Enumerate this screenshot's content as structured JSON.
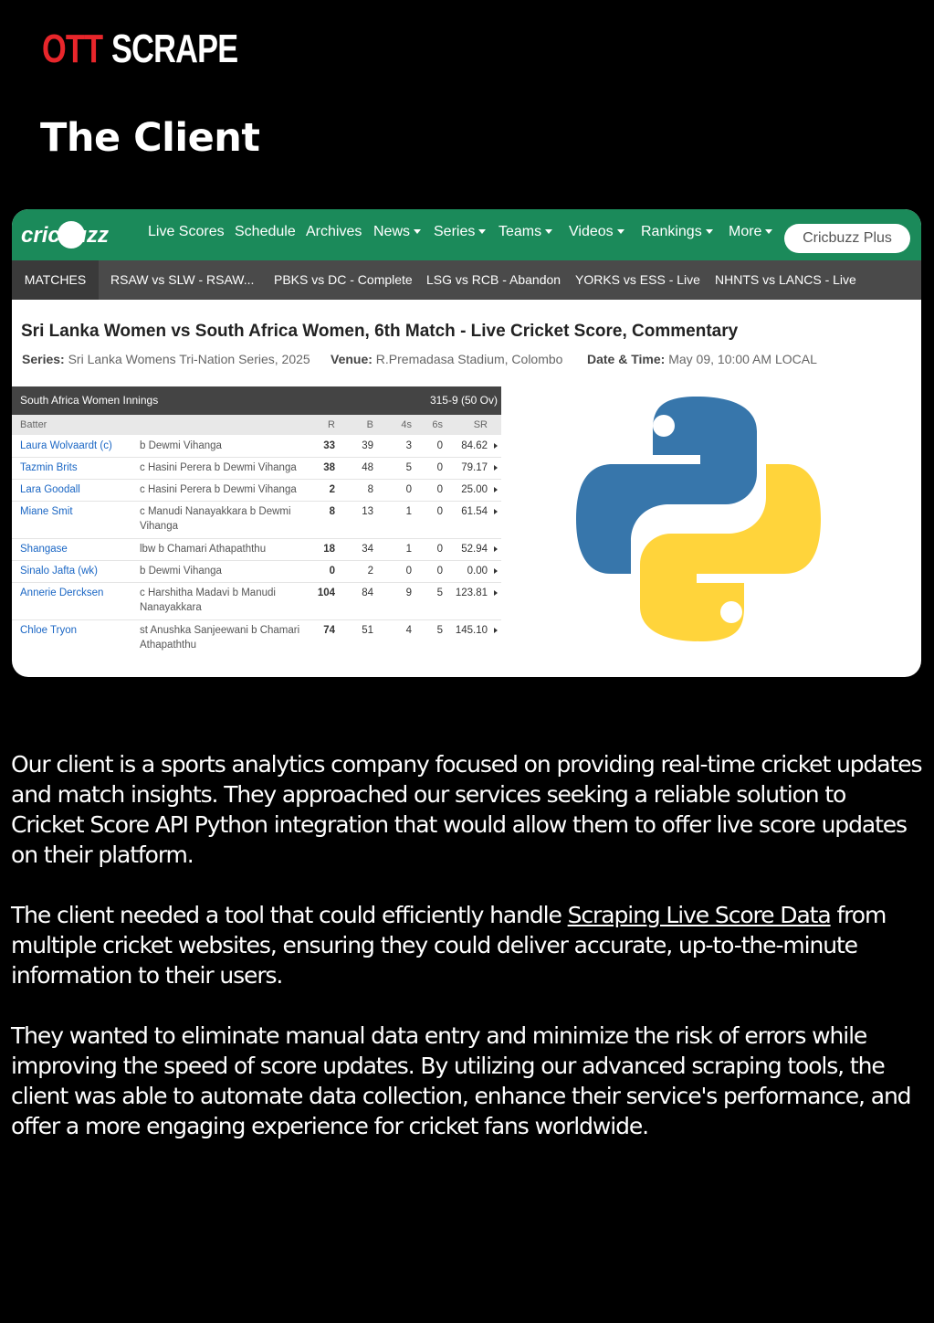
{
  "brand": {
    "logo_ott": "OTT",
    "logo_scrape": "SCRAPE",
    "ott_color": "#e8262b"
  },
  "section_title": "The Client",
  "screenshot": {
    "site_logo": "cricbuzz",
    "nav": [
      "Live Scores",
      "Schedule",
      "Archives",
      "News",
      "Series",
      "Teams",
      "Videos",
      "Rankings",
      "More"
    ],
    "plus_button": "Cricbuzz Plus",
    "matches_label": "MATCHES",
    "matches": [
      "RSAW vs SLW - RSAW...",
      "PBKS vs DC - Complete",
      "LSG vs RCB - Abandon",
      "YORKS vs ESS - Live",
      "NHNTS vs LANCS - Live"
    ],
    "title": "Sri Lanka Women vs South Africa Women, 6th Match - Live Cricket Score, Commentary",
    "series_label": "Series:",
    "series": "Sri Lanka Womens Tri-Nation Series, 2025",
    "venue_label": "Venue:",
    "venue": "R.Premadasa Stadium, Colombo",
    "date_label": "Date & Time:",
    "date": "May 09, 10:00 AM LOCAL",
    "innings_team": "South Africa Women Innings",
    "innings_total": "315-9 (50 Ov)",
    "columns": {
      "batter": "Batter",
      "r": "R",
      "b": "B",
      "fours": "4s",
      "sixes": "6s",
      "sr": "SR"
    },
    "rows": [
      {
        "batter": "Laura Wolvaardt (c)",
        "dismissal": "b Dewmi Vihanga",
        "r": "33",
        "b": "39",
        "fours": "3",
        "sixes": "0",
        "sr": "84.62"
      },
      {
        "batter": "Tazmin Brits",
        "dismissal": "c Hasini Perera b Dewmi Vihanga",
        "r": "38",
        "b": "48",
        "fours": "5",
        "sixes": "0",
        "sr": "79.17"
      },
      {
        "batter": "Lara Goodall",
        "dismissal": "c Hasini Perera b Dewmi Vihanga",
        "r": "2",
        "b": "8",
        "fours": "0",
        "sixes": "0",
        "sr": "25.00"
      },
      {
        "batter": "Miane Smit",
        "dismissal": "c Manudi Nanayakkara b Dewmi Vihanga",
        "r": "8",
        "b": "13",
        "fours": "1",
        "sixes": "0",
        "sr": "61.54"
      },
      {
        "batter": "Shangase",
        "dismissal": "lbw b Chamari Athapaththu",
        "r": "18",
        "b": "34",
        "fours": "1",
        "sixes": "0",
        "sr": "52.94"
      },
      {
        "batter": "Sinalo Jafta (wk)",
        "dismissal": "b Dewmi Vihanga",
        "r": "0",
        "b": "2",
        "fours": "0",
        "sixes": "0",
        "sr": "0.00"
      },
      {
        "batter": "Annerie Dercksen",
        "dismissal": "c Harshitha Madavi b Manudi Nanayakkara",
        "r": "104",
        "b": "84",
        "fours": "9",
        "sixes": "5",
        "sr": "123.81"
      },
      {
        "batter": "Chloe Tryon",
        "dismissal": "st Anushka Sanjeewani b Chamari Athapaththu",
        "r": "74",
        "b": "51",
        "fours": "4",
        "sixes": "5",
        "sr": "145.10"
      }
    ]
  },
  "paragraphs": {
    "p1": "Our client is a sports analytics company focused on providing real-time cricket updates and match insights. They approached our services seeking a reliable solution to Cricket Score API Python integration that would allow them to offer live score updates on their platform.",
    "p2_before": "The client needed a tool that could efficiently handle ",
    "p2_link": "Scraping Live Score Data",
    "p2_after": " from multiple cricket websites, ensuring they could deliver accurate, up-to-the-minute information to their users.",
    "p3": "They wanted to eliminate manual data entry and minimize the risk of errors while improving the speed of score updates. By utilizing our advanced scraping tools, the client was able to automate data collection, enhance their service's performance, and offer a more engaging experience for cricket fans worldwide."
  }
}
